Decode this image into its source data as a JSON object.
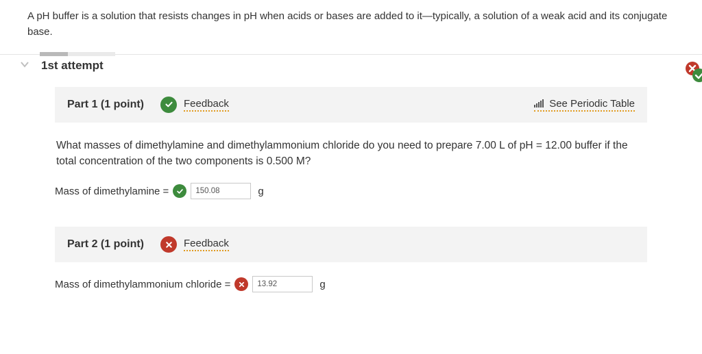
{
  "intro": "A pH buffer is a solution that resists changes in pH when acids or bases are added to it—typically, a solution of a weak acid and its conjugate base.",
  "attempt_title": "1st attempt",
  "periodic_link": "See Periodic Table",
  "feedback_label": "Feedback",
  "part1": {
    "header": "Part 1   (1 point)",
    "question": "What masses of dimethylamine and dimethylammonium chloride do you need to prepare 7.00 L of pH = 12.00 buffer if the total concentration of the two components is 0.500 M?",
    "answer_label": "Mass of dimethylamine = ",
    "answer_value": "150.08",
    "unit": "g",
    "status": "correct"
  },
  "part2": {
    "header": "Part 2   (1 point)",
    "answer_label": "Mass of dimethylammonium chloride = ",
    "answer_value": "13.92",
    "unit": "g",
    "status": "incorrect"
  }
}
